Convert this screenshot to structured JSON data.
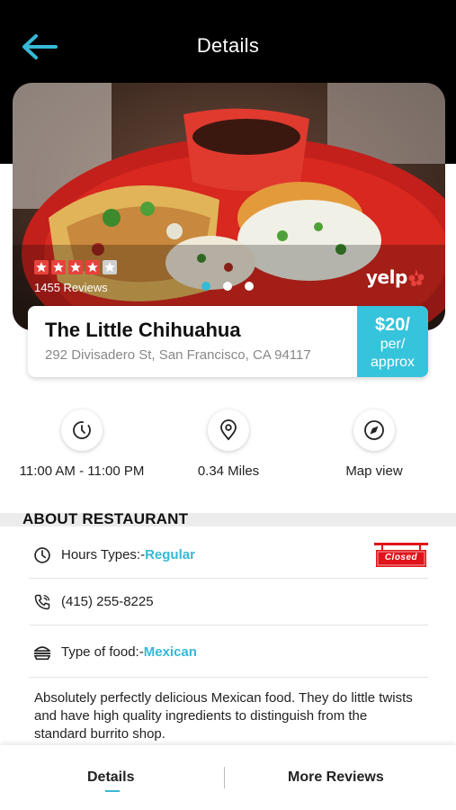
{
  "header": {
    "title": "Details",
    "back_icon": "arrow-left-icon",
    "accent": "#36b9d6"
  },
  "hero": {
    "rating_stars": 4,
    "rating_max": 5,
    "reviews_text": "1455 Reviews",
    "carousel_pages": 3,
    "carousel_active": 0,
    "provider_logo": "yelp"
  },
  "restaurant": {
    "name": "The Little Chihuahua",
    "address": "292 Divisadero St, San Francisco, CA 94117",
    "price_amount": "$20/",
    "price_per": "per/",
    "price_approx": "approx"
  },
  "quick_actions": [
    {
      "label": "11:00 AM - 11:00 PM",
      "icon": "clock-icon"
    },
    {
      "label": "0.34 Miles",
      "icon": "location-pin-icon"
    },
    {
      "label": "Map view",
      "icon": "navigation-arrow-icon"
    }
  ],
  "about": {
    "title": "ABOUT RESTAURANT",
    "hours_label": "Hours Types:- ",
    "hours_value": "Regular",
    "status_sign": "Closed",
    "phone": "(415) 255-8225",
    "food_label": "Type of food:- ",
    "food_value": "Mexican",
    "description": "Absolutely perfectly delicious Mexican food. They do little twists and have high quality ingredients to distinguish from the standard burrito shop."
  },
  "bottom_nav": {
    "details": "Details",
    "more_reviews": "More Reviews"
  },
  "colors": {
    "header_bg": "#000000",
    "accent": "#36b9d6",
    "price_bg": "#36c3dc",
    "star": "#e8413c",
    "closed_red": "#e0141b"
  }
}
